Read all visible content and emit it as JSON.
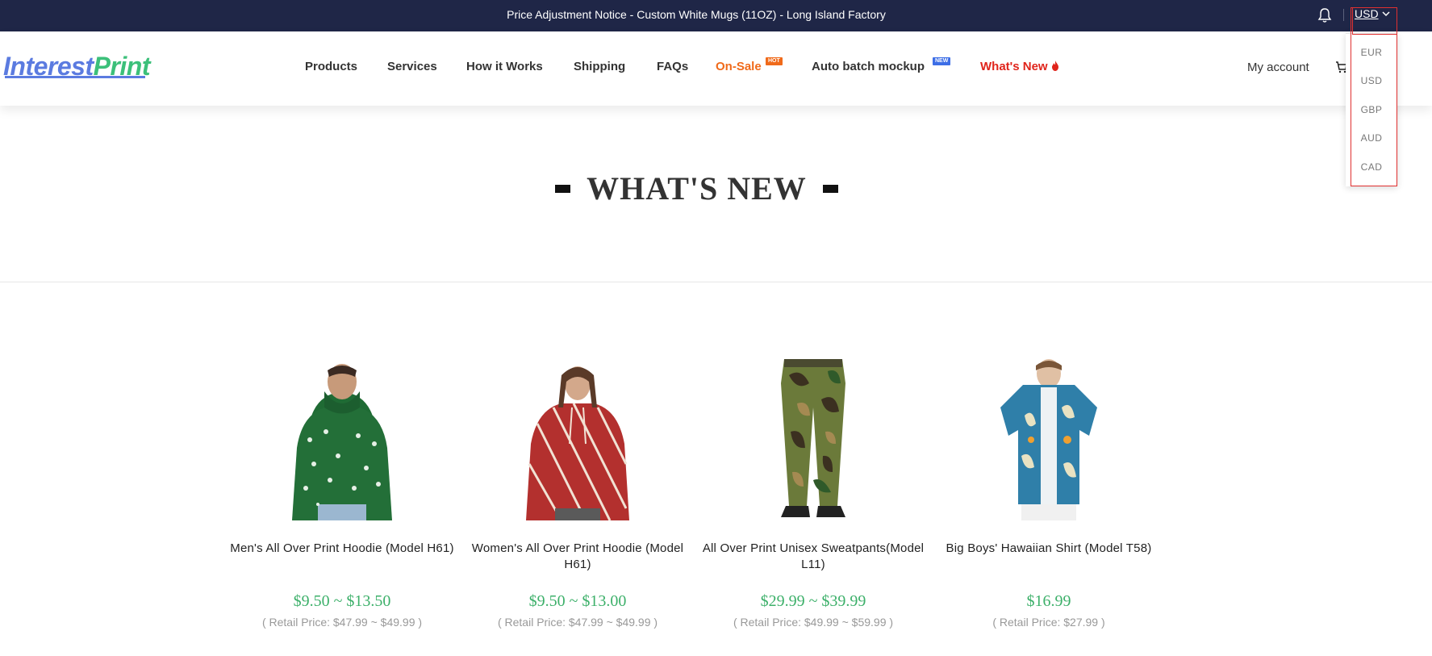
{
  "topbar": {
    "notice": "Price Adjustment Notice - Custom White Mugs (11OZ) - Long Island Factory",
    "currency": "USD"
  },
  "header": {
    "logo_part1": "Interest",
    "logo_part2": "Print",
    "nav": [
      {
        "label": "Products"
      },
      {
        "label": "Services"
      },
      {
        "label": "How it Works"
      },
      {
        "label": "Shipping"
      },
      {
        "label": "FAQs"
      },
      {
        "label": "On-Sale",
        "badge": "HOT"
      },
      {
        "label": "Auto batch mockup",
        "badge": "NEW"
      },
      {
        "label": "What's New"
      }
    ],
    "account": "My account"
  },
  "currency_options": [
    "EUR",
    "USD",
    "GBP",
    "AUD",
    "CAD"
  ],
  "section": {
    "title": "WHAT'S NEW"
  },
  "products": [
    {
      "name": "Men's All Over Print Hoodie (Model H61)",
      "price": "$9.50 ~ $13.50",
      "retail": "( Retail Price: $47.99 ~ $49.99 )",
      "icon": "green-snowflake-hoodie"
    },
    {
      "name": "Women's All Over Print Hoodie (Model H61)",
      "price": "$9.50 ~ $13.00",
      "retail": "( Retail Price: $47.99 ~ $49.99 )",
      "icon": "red-striped-hoodie"
    },
    {
      "name": "All Over Print Unisex Sweatpants(Model L11)",
      "price": "$29.99 ~ $39.99",
      "retail": "( Retail Price: $49.99 ~ $59.99 )",
      "icon": "camo-sweatpants"
    },
    {
      "name": "Big Boys' Hawaiian Shirt (Model T58)",
      "price": "$16.99",
      "retail": "( Retail Price: $27.99 )",
      "icon": "blue-hawaiian-shirt"
    }
  ],
  "colors": {
    "topbar": "#1f2647",
    "accent_green": "#3db06a",
    "sale": "#f06a1a",
    "new": "#e0241b",
    "logo_blue": "#5b7be0",
    "logo_green": "#3cc07a"
  }
}
